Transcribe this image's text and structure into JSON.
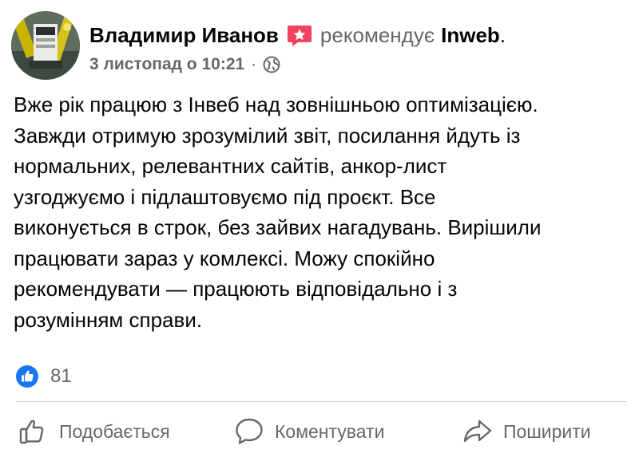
{
  "post": {
    "author": {
      "name": "Владимир Иванов",
      "avatar_icon": "avatar-photo"
    },
    "recommend_icon": "recommend-star-icon",
    "recommend_color": "#f3425f",
    "recommend_text": "рекомендує",
    "page_name": "Inweb",
    "period": ".",
    "timestamp": "3 листопад о 10:21",
    "separator": "·",
    "privacy_icon": "globe-icon",
    "text": "Вже рік працюю з Інвеб над зовнішньою оптимізацією.\nЗавжди отримую зрозумілий звіт, посилання йдуть із\nнормальних, релевантних сайтів, анкор-лист\nузгоджуємо і підлаштовуємо під проєкт. Все\nвиконується в строк, без зайвих нагадувань.  Вирішили\nпрацювати зараз у комлексі. Можу спокійно\nрекомендувати — працюють відповідально і з\nрозумінням справи."
  },
  "reactions": {
    "icon": "like-reaction-icon",
    "color": "#1877f2",
    "count": "81"
  },
  "actions": [
    {
      "icon": "thumbs-up-icon",
      "label": "Подобається"
    },
    {
      "icon": "comment-icon",
      "label": "Коментувати"
    },
    {
      "icon": "share-icon",
      "label": "Поширити"
    }
  ],
  "colors": {
    "primary_text": "#050505",
    "secondary_text": "#65676b",
    "divider": "#ced0d4"
  }
}
